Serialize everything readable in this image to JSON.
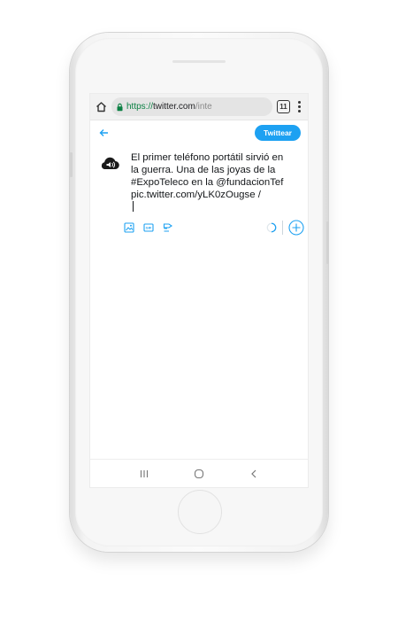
{
  "browser": {
    "url_scheme": "https://",
    "url_host": "twitter.com",
    "url_path": "/inte",
    "tab_count": "11",
    "icons": {
      "home": "home-icon",
      "lock": "lock-icon",
      "menu": "more-vert-icon"
    },
    "secure_color": "#0b8043"
  },
  "twitter": {
    "tweet_button_label": "Twittear",
    "accent_color": "#1da1f2",
    "tweet_lines": [
      "El primer teléfono portátil sirvió en",
      "la guerra. Una de las joyas de la",
      "#ExpoTeleco en la @fundacionTef",
      "pic.twitter.com/yLK0zOugse /"
    ],
    "toolbar_icons": [
      "image-icon",
      "gif-icon",
      "poll-icon",
      "progress-ring-icon",
      "add-tweet-icon"
    ]
  },
  "system_nav": {
    "icons": [
      "recent-apps-icon",
      "home-circle-icon",
      "back-chevron-icon"
    ]
  }
}
